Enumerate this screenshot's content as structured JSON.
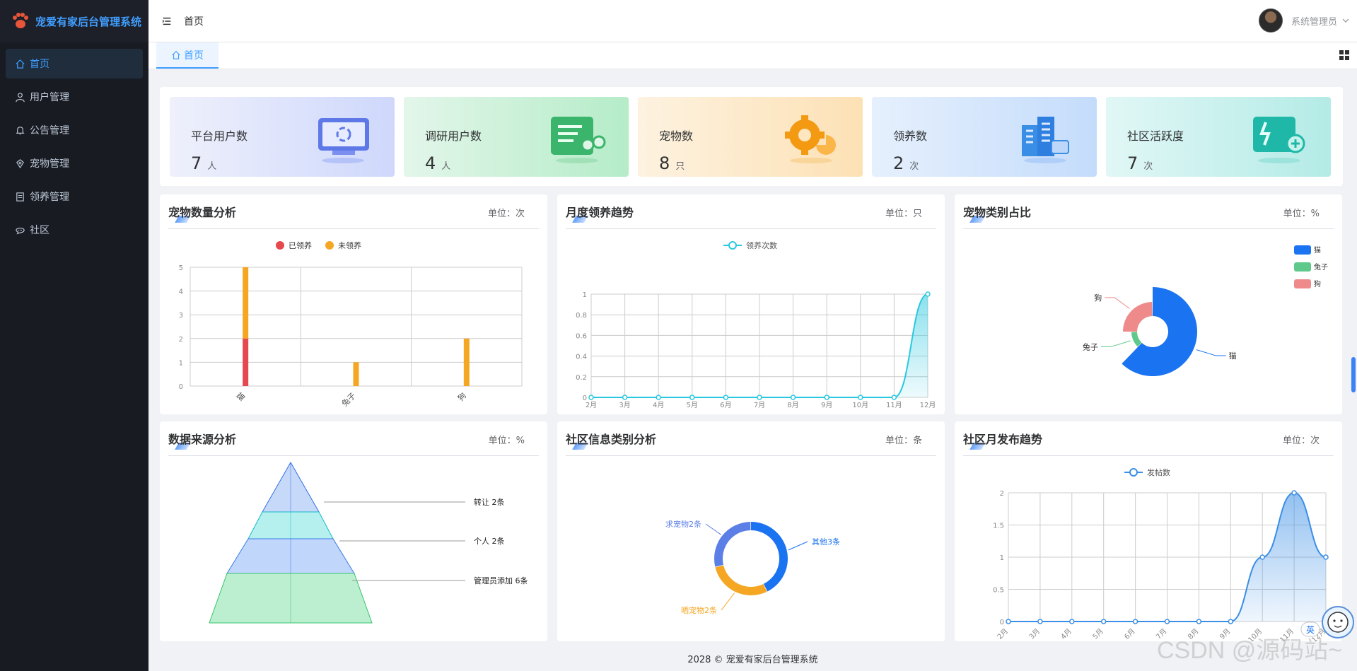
{
  "app": {
    "title": "宠爱有家后台管理系统",
    "footer": "2028 © 宠爱有家后台管理系统"
  },
  "sidebar": {
    "items": [
      {
        "label": "首页",
        "icon": "home-icon",
        "active": true
      },
      {
        "label": "用户管理",
        "icon": "user-icon"
      },
      {
        "label": "公告管理",
        "icon": "bell-icon"
      },
      {
        "label": "宠物管理",
        "icon": "pet-icon"
      },
      {
        "label": "领养管理",
        "icon": "document-icon"
      },
      {
        "label": "社区",
        "icon": "chat-icon"
      }
    ]
  },
  "header": {
    "breadcrumb": "首页",
    "username": "系统管理员"
  },
  "tags": {
    "active_tab": "首页"
  },
  "stats": [
    {
      "title": "平台用户数",
      "value": "7",
      "unit": "人"
    },
    {
      "title": "调研用户数",
      "value": "4",
      "unit": "人"
    },
    {
      "title": "宠物数",
      "value": "8",
      "unit": "只"
    },
    {
      "title": "领养数",
      "value": "2",
      "unit": "次"
    },
    {
      "title": "社区活跃度",
      "value": "7",
      "unit": "次"
    }
  ],
  "cards": {
    "pet_count": {
      "title": "宠物数量分析",
      "unit": "单位：次"
    },
    "monthly_adopt": {
      "title": "月度领养趋势",
      "unit": "单位：只"
    },
    "pet_type": {
      "title": "宠物类别占比",
      "unit": "单位：%"
    },
    "data_source": {
      "title": "数据来源分析",
      "unit": "单位：%"
    },
    "community_type": {
      "title": "社区信息类别分析",
      "unit": "单位：条"
    },
    "community_monthly": {
      "title": "社区月发布趋势",
      "unit": "单位：次"
    }
  },
  "chart_data": [
    {
      "type": "bar",
      "title": "宠物数量分析",
      "categories": [
        "猫",
        "兔子",
        "狗"
      ],
      "stacked": true,
      "series": [
        {
          "name": "已领养",
          "values": [
            2,
            0,
            0
          ],
          "color": "#e5484d"
        },
        {
          "name": "未领养",
          "values": [
            3,
            1,
            2
          ],
          "color": "#f5a623"
        }
      ],
      "ylim": [
        0,
        5
      ],
      "yticks": [
        0,
        1,
        2,
        3,
        4,
        5
      ],
      "legend": "top-center",
      "grid": true
    },
    {
      "type": "area",
      "title": "月度领养趋势",
      "x": [
        "2月",
        "3月",
        "4月",
        "5月",
        "6月",
        "7月",
        "8月",
        "9月",
        "10月",
        "11月",
        "12月"
      ],
      "series": [
        {
          "name": "领养次数",
          "values": [
            0,
            0,
            0,
            0,
            0,
            0,
            0,
            0,
            0,
            0,
            1
          ],
          "color": "#2ac8e0"
        }
      ],
      "ylim": [
        0,
        1
      ],
      "yticks": [
        "0",
        "0.2",
        "0.4",
        "0.6",
        "0.8",
        "1"
      ],
      "legend": "top-center",
      "grid": true
    },
    {
      "type": "pie",
      "title": "宠物类别占比",
      "slices": [
        {
          "name": "猫",
          "value": 5,
          "color": "#1a73f0"
        },
        {
          "name": "兔子",
          "value": 1,
          "color": "#5ec98a"
        },
        {
          "name": "狗",
          "value": 2,
          "color": "#ee8a8a"
        }
      ],
      "legend": "top-right"
    },
    {
      "type": "funnel",
      "title": "数据来源分析",
      "levels": [
        {
          "label": "转让 2条",
          "value": 2
        },
        {
          "label": "个人 2条",
          "value": 2
        },
        {
          "label": "管理员添加 6条",
          "value": 6
        }
      ]
    },
    {
      "type": "pie",
      "title": "社区信息类别分析",
      "slices": [
        {
          "name": "其他",
          "label": "其他3条",
          "value": 3,
          "color": "#1a73f0"
        },
        {
          "name": "晒宠物",
          "label": "晒宠物2条",
          "value": 2,
          "color": "#f5a623"
        },
        {
          "name": "求宠物",
          "label": "求宠物2条",
          "value": 2,
          "color": "#5b7fe6"
        }
      ]
    },
    {
      "type": "area",
      "title": "社区月发布趋势",
      "x": [
        "2月",
        "3月",
        "4月",
        "5月",
        "6月",
        "7月",
        "8月",
        "9月",
        "10月",
        "11月",
        "12月"
      ],
      "series": [
        {
          "name": "发帖数",
          "values": [
            0,
            0,
            0,
            0,
            0,
            0,
            0,
            0,
            1,
            2,
            1
          ],
          "color": "#3a8ee6"
        }
      ],
      "ylim": [
        0,
        2
      ],
      "yticks": [
        "0",
        "0.5",
        "1",
        "1.5",
        "2"
      ],
      "legend": "top-center",
      "grid": true
    }
  ],
  "overlay": {
    "ime": "英",
    "watermark": "CSDN @源码站~"
  }
}
